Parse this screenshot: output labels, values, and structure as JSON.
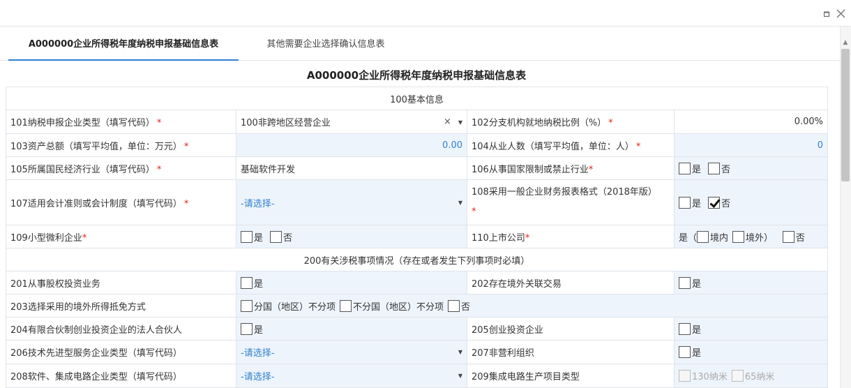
{
  "tabs": [
    {
      "label": "A000000企业所得税年度纳税申报基础信息表",
      "active": true
    },
    {
      "label": "其他需要企业选择确认信息表",
      "active": false
    }
  ],
  "form_title": "A000000企业所得税年度纳税申报基础信息表",
  "sections": {
    "s100": "100基本信息",
    "s200": "200有关涉税事项情况（存在或者发生下列事项时必填）"
  },
  "fields": {
    "f101": {
      "label": "101纳税申报企业类型（填写代码）",
      "req": "*",
      "value": "100非跨地区经营企业"
    },
    "f102": {
      "label": "102分支机构就地纳税比例（%）",
      "req": "*",
      "value": "0.00%"
    },
    "f103": {
      "label": "103资产总额（填写平均值，单位：万元）",
      "req": "*",
      "value": "0.00"
    },
    "f104": {
      "label": "104从业人数（填写平均值，单位：人）",
      "req": "*",
      "value": "0"
    },
    "f105": {
      "label": "105所属国民经济行业（填写代码）",
      "req": "*",
      "value": "基础软件开发"
    },
    "f106": {
      "label": "106从事国家限制或禁止行业",
      "req": "*",
      "opt_yes": "是",
      "opt_no": "否"
    },
    "f107": {
      "label": "107适用会计准则或会计制度（填写代码）",
      "req": "*",
      "value": "-请选择-"
    },
    "f108": {
      "label": "108采用一般企业财务报表格式（2018年版）",
      "req": "*",
      "opt_yes": "是",
      "opt_no": "否"
    },
    "f109": {
      "label": "109小型微利企业",
      "req": "*",
      "opt_yes": "是",
      "opt_no": "否"
    },
    "f110": {
      "label": "110上市公司",
      "req": "*",
      "opt_prefix": "是（",
      "opt_domestic": "境内",
      "opt_foreign": "境外）",
      "opt_no": "否"
    },
    "f201": {
      "label": "201从事股权投资业务",
      "opt_yes": "是"
    },
    "f202": {
      "label": "202存在境外关联交易",
      "opt_yes": "是"
    },
    "f203": {
      "label": "203选择采用的境外所得抵免方式",
      "opt_a": "分国（地区）不分项",
      "opt_b": "不分国（地区）不分项",
      "opt_no": "否"
    },
    "f204": {
      "label": "204有限合伙制创业投资企业的法人合伙人",
      "opt_yes": "是"
    },
    "f205": {
      "label": "205创业投资企业",
      "opt_yes": "是"
    },
    "f206": {
      "label": "206技术先进型服务企业类型（填写代码）",
      "value": "-请选择-"
    },
    "f207": {
      "label": "207非营利组织",
      "opt_yes": "是"
    },
    "f208": {
      "label": "208软件、集成电路企业类型（填写代码）",
      "value": "-请选择-"
    },
    "f209": {
      "label": "209集成电路生产项目类型",
      "opt_a": "130纳米",
      "opt_b": "65纳米"
    }
  }
}
